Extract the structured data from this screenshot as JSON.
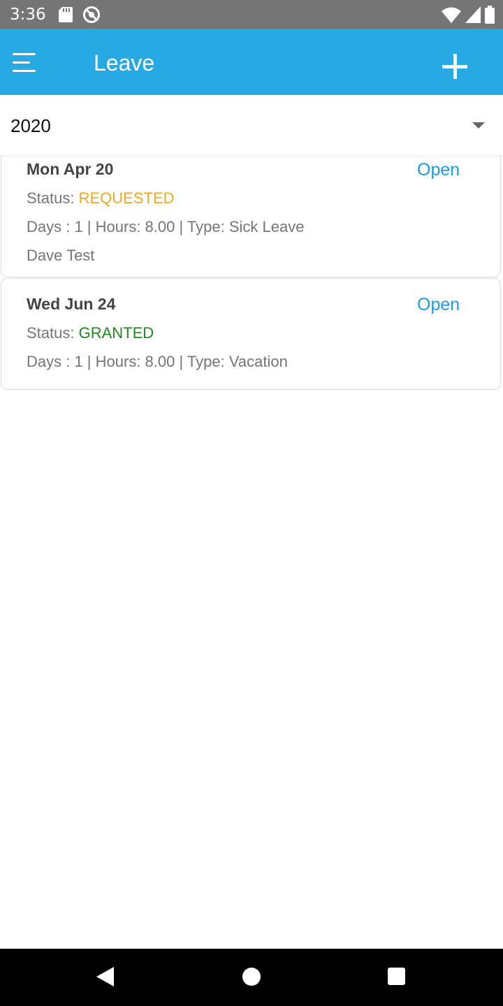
{
  "status_bar": {
    "time": "3:36"
  },
  "app_bar": {
    "title": "Leave"
  },
  "year_filter": {
    "selected": "2020"
  },
  "leave_items": [
    {
      "date": "Mon Apr 20",
      "action": "Open",
      "status_label": "Status: ",
      "status_value": "REQUESTED",
      "details": "Days : 1 | Hours: 8.00 | Type: Sick Leave",
      "employee": "Dave Test"
    },
    {
      "date": "Wed Jun 24",
      "action": "Open",
      "status_label": "Status: ",
      "status_value": "GRANTED",
      "details": "Days : 1 | Hours: 8.00 | Type: Vacation"
    }
  ],
  "colors": {
    "app_bar": "#27a9e3",
    "open_link": "#1e9be0",
    "status_requested": "#f5a623",
    "status_granted": "#1f8a1f"
  }
}
